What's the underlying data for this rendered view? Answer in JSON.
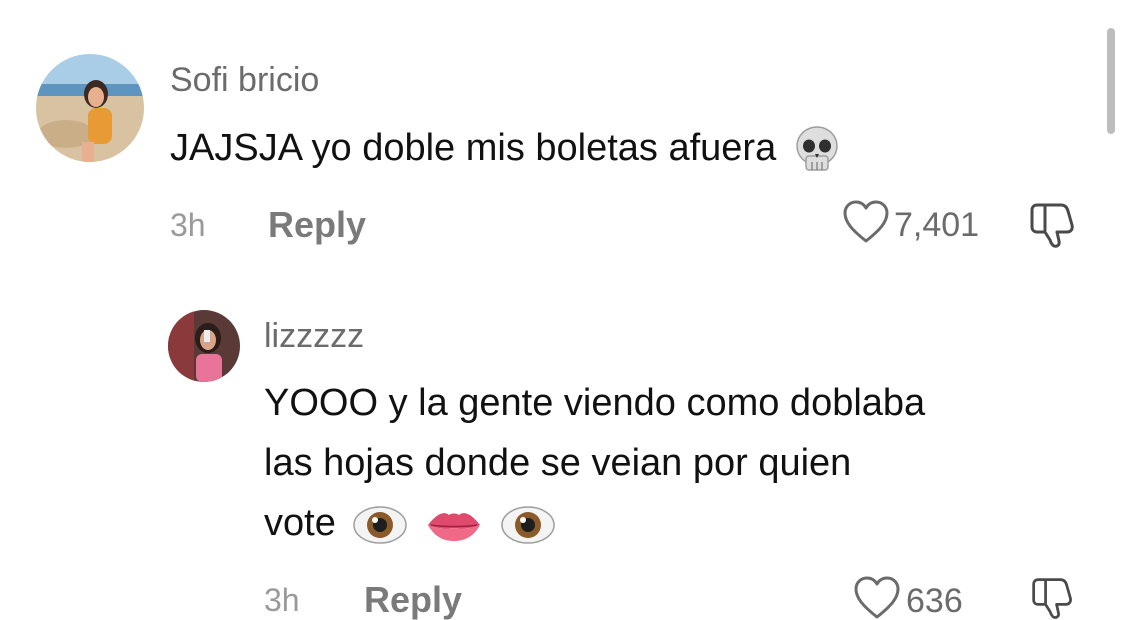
{
  "comments": [
    {
      "username": "Sofi bricio",
      "text": "JAJSJA yo doble mis boletas afuera",
      "emojis": [
        "skull-emoji"
      ],
      "time": "3h",
      "reply_label": "Reply",
      "likes": "7,401"
    },
    {
      "username": "lizzzzz",
      "text_lines": [
        "YOOO y la gente viendo como doblaba",
        "las hojas donde se veian por quien",
        "vote"
      ],
      "emojis": [
        "eyes-emoji",
        "lips-emoji",
        "eyes-emoji"
      ],
      "time": "3h",
      "reply_label": "Reply",
      "likes": "636"
    }
  ]
}
